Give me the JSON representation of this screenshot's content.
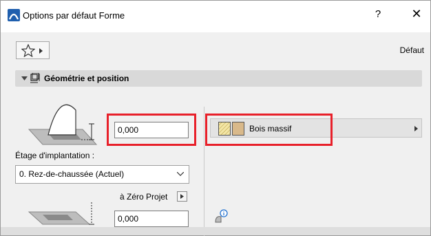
{
  "window": {
    "title": "Options par défaut Forme",
    "help": "?",
    "close": "✕"
  },
  "toolbar": {
    "default_label": "Défaut"
  },
  "section": {
    "title": "Géométrie et position"
  },
  "geometry": {
    "height_value": "0,000",
    "floor_label": "Étage d'implantation :",
    "floor_selected": "0. Rez-de-chaussée (Actuel)",
    "offset_label": "à Zéro Projet",
    "offset_value": "0,000"
  },
  "material": {
    "name": "Bois massif"
  },
  "colors": {
    "highlight": "#e8202a",
    "app_icon": "#1f5fae"
  }
}
